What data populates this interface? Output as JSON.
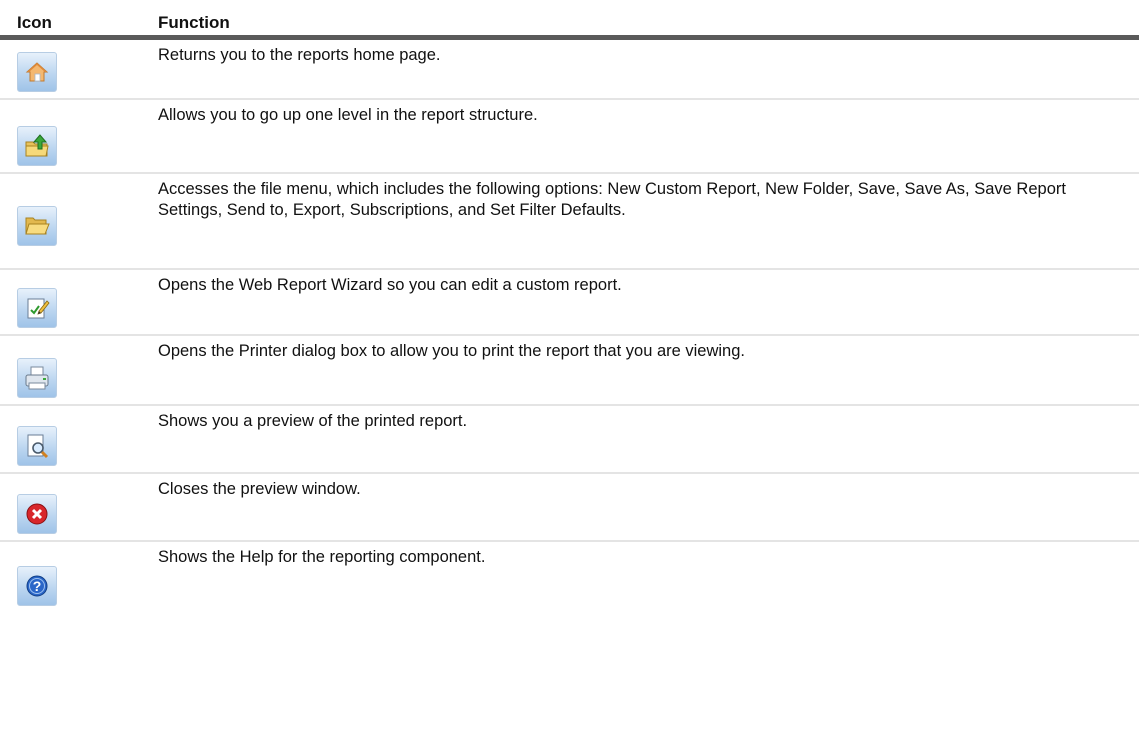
{
  "table": {
    "headers": {
      "icon": "Icon",
      "function": "Function"
    },
    "rows": [
      {
        "icon": "home-icon",
        "description": "Returns you to the reports home page."
      },
      {
        "icon": "folder-up-icon",
        "description": "Allows you to go up one level in the report structure."
      },
      {
        "icon": "open-folder-icon",
        "description": "Accesses the file menu, which includes the following options: New Custom Report, New Folder, Save, Save As, Save Report Settings, Send to, Export, Subscriptions, and Set Filter Defaults."
      },
      {
        "icon": "edit-report-icon",
        "description": "Opens the Web Report Wizard so you can edit a custom report."
      },
      {
        "icon": "printer-icon",
        "description": "Opens the Printer dialog box to allow you to print the report that you are viewing."
      },
      {
        "icon": "print-preview-icon",
        "description": "Shows you a preview of the printed report."
      },
      {
        "icon": "close-icon",
        "description": "Closes the preview window."
      },
      {
        "icon": "help-icon",
        "description": "Shows the Help for the reporting component."
      }
    ]
  }
}
